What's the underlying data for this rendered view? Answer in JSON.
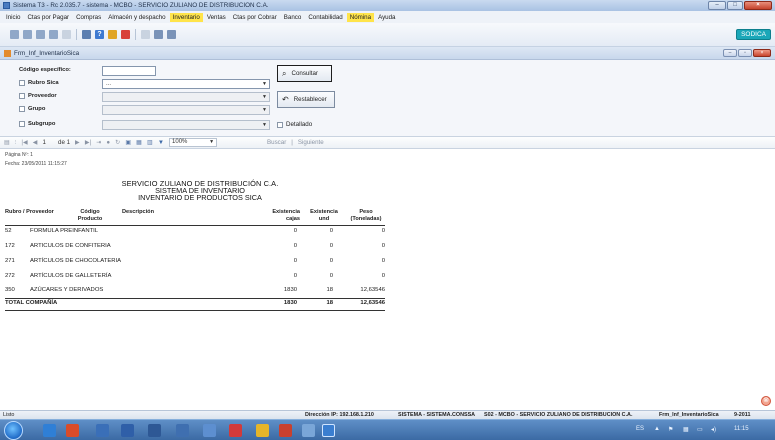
{
  "window": {
    "title": "Sistema T3 - Rc 2.035.7 - sistema - MCBO - SERVICIO ZULIANO DE DISTRIBUCION C.A."
  },
  "menu": [
    "Inicio",
    "Ctas por Pagar",
    "Compras",
    "Almacén y despacho",
    "Inventario",
    "Ventas",
    "Ctas por Cobrar",
    "Banco",
    "Contabilidad",
    "Nómina",
    "Ayuda"
  ],
  "menu_highlighted": [
    "Inventario",
    "Nómina"
  ],
  "toolbar": {
    "brand": "SODICA"
  },
  "form": {
    "title": "Frm_Inf_InventarioSica",
    "codigo_label": "Código específico:",
    "codigo_value": "",
    "rubro_label": "Rubro Sica",
    "rubro_value": "...",
    "proveedor_label": "Proveedor",
    "grupo_label": "Grupo",
    "subgrupo_label": "Subgrupo",
    "detallado_label": "Detallado",
    "consultar_label": "Consultar",
    "restablecer_label": "Restablecer"
  },
  "viewer": {
    "page_current": "1",
    "page_of": "de 1",
    "zoom": "100%",
    "find": "Buscar",
    "next": "Siguiente"
  },
  "report": {
    "page_label": "Página Nº: 1",
    "date_label": "Fecha: 23/05/2011 11:15:27",
    "heading1": "SERVICIO ZULIANO DE DISTRIBUCIÓN C.A.",
    "heading2": "SISTEMA DE INVENTARIO",
    "heading3": "INVENTARIO DE PRODUCTOS SICA",
    "columns": {
      "rubro": "Rubro / Proveedor",
      "codigo": "Código Producto",
      "descripcion": "Descripción",
      "cajas": "Existencia cajas",
      "und": "Existencia und",
      "peso": "Peso (Toneladas)"
    },
    "rows": [
      {
        "codigo": "52",
        "descripcion": "FORMULA PREINFANTIL",
        "cajas": "0",
        "und": "0",
        "peso": "0"
      },
      {
        "codigo": "172",
        "descripcion": "ARTICULOS DE CONFITERIA",
        "cajas": "0",
        "und": "0",
        "peso": "0"
      },
      {
        "codigo": "271",
        "descripcion": "ARTÍCULOS DE CHOCOLATERIA",
        "cajas": "0",
        "und": "0",
        "peso": "0"
      },
      {
        "codigo": "272",
        "descripcion": "ARTÍCULOS DE GALLETERÍA",
        "cajas": "0",
        "und": "0",
        "peso": "0"
      },
      {
        "codigo": "350",
        "descripcion": "AZÚCARES Y DERIVADOS",
        "cajas": "1830",
        "und": "18",
        "peso": "12,63546"
      }
    ],
    "total": {
      "label": "TOTAL COMPAÑÍA",
      "cajas": "1830",
      "und": "18",
      "peso": "12,63546"
    }
  },
  "status": {
    "left": "Listo",
    "ip": "Dirección IP: 192.168.1.210",
    "system": "SISTEMA - SISTEMA.CONSSA",
    "company": "S02 - MCBO - SERVICIO ZULIANO DE DISTRIBUCION C.A.",
    "form": "Frm_Inf_InventarioSica",
    "period": "9-2011"
  },
  "taskbar": {
    "lang": "ES",
    "time": "11:15"
  }
}
